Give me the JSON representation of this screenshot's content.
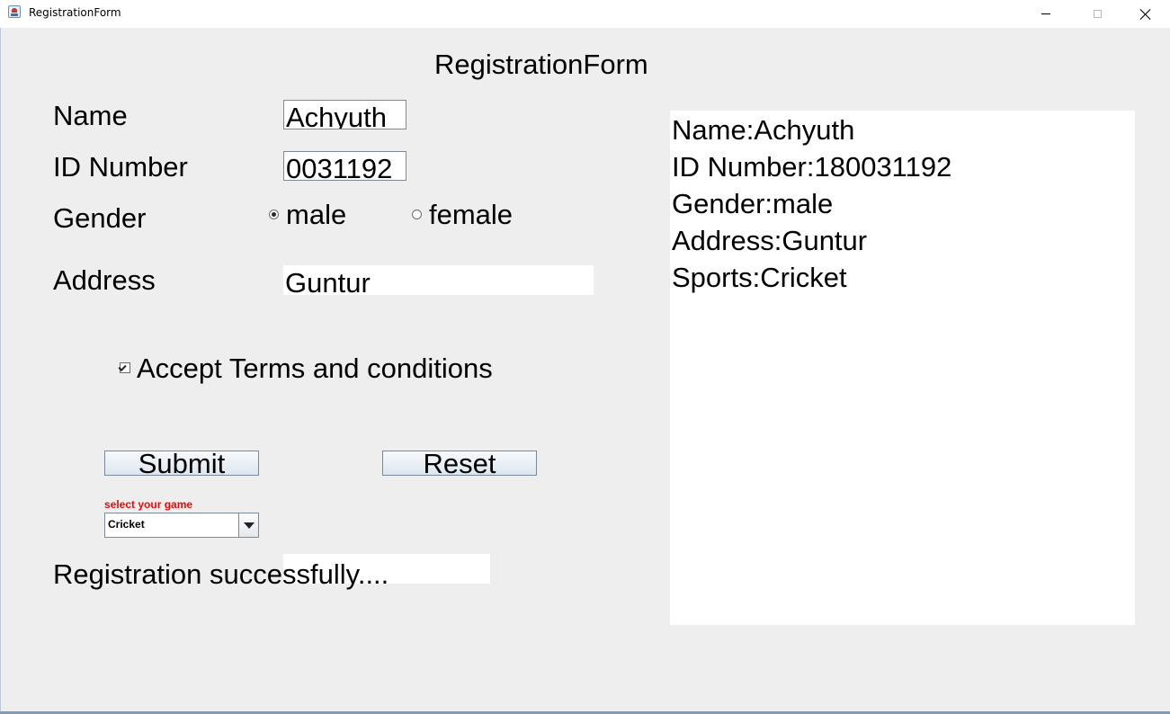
{
  "window": {
    "title": "RegistrationForm",
    "icon": "java-cup-icon"
  },
  "form": {
    "heading": "RegistrationForm",
    "name_label": "Name",
    "name_value": "Achyuth",
    "id_label": "ID Number",
    "id_value": "0031192",
    "gender_label": "Gender",
    "gender_options": [
      "male",
      "female"
    ],
    "gender_selected": "male",
    "address_label": "Address",
    "address_value": "Guntur",
    "terms_label": "Accept Terms and conditions",
    "terms_checked": true,
    "submit_label": "Submit",
    "reset_label": "Reset",
    "game_label": "select your game",
    "game_label_color": "#ff0000",
    "game_selected": "Cricket",
    "status_text": "Registration successfully...."
  },
  "output": {
    "lines": [
      "Name:Achyuth",
      "ID Number:180031192",
      "Gender:male",
      "Address:Guntur",
      "Sports:Cricket"
    ]
  },
  "colors": {
    "panel_background": "#eeeeee",
    "field_background": "#ffffff",
    "border": "#7a8a99"
  }
}
